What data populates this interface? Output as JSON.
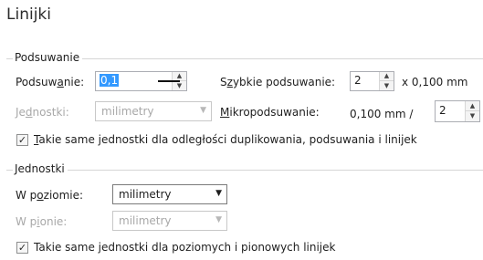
{
  "title": "Linijki",
  "nudge_group": {
    "legend": "Podsuwanie",
    "nudge_label_pre": "Podsuw",
    "nudge_label_ul": "a",
    "nudge_label_post": "nie:",
    "nudge_value": "0,1",
    "super_label_pre": "S",
    "super_label_ul": "z",
    "super_label_post": "ybkie podsuwanie:",
    "super_value": "2",
    "super_suffix": "x 0,100 mm",
    "units_label_pre": "Je",
    "units_label_ul": "d",
    "units_label_post": "nostki:",
    "units_value": "milimetry",
    "micro_label_ul": "M",
    "micro_label_post": "ikropodsuwanie:",
    "micro_value": "0,100 mm /",
    "micro_divisor": "2",
    "same_units_ul": "T",
    "same_units_post": "akie same jednostki dla odległości duplikowania, podsuwania i linijek"
  },
  "units_group": {
    "legend": "Jednostki",
    "horizontal_label_pre": "W p",
    "horizontal_label_ul": "o",
    "horizontal_label_post": "ziomie:",
    "horizontal_value": "milimetry",
    "vertical_label_pre": "W p",
    "vertical_label_ul": "i",
    "vertical_label_post": "onie:",
    "vertical_value": "milimetry",
    "same_units_pre": "Takie same ",
    "same_units_ul": "j",
    "same_units_post": "ednostki dla poziomych i pionowych linijek"
  }
}
